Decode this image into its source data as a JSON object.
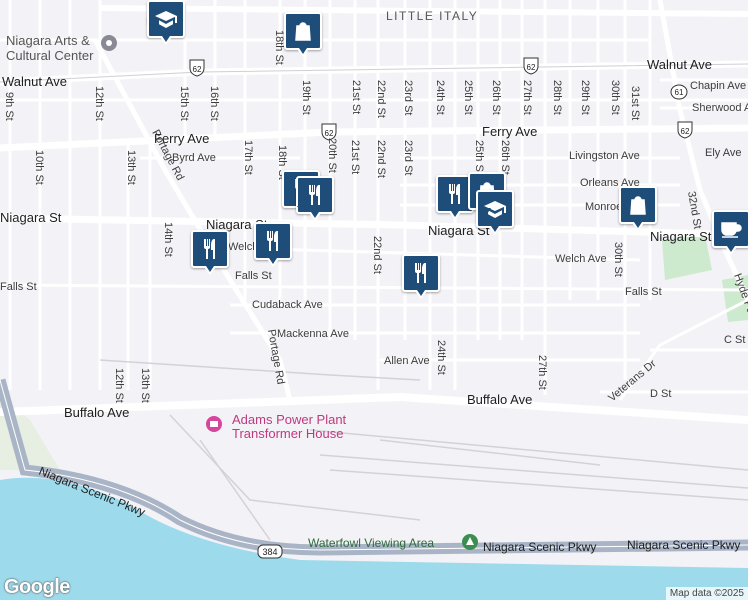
{
  "map": {
    "brand": "Google",
    "attribution": "Map data ©2025",
    "neighborhood": "LITTLE ITALY",
    "places": {
      "arts_center_line1": "Niagara Arts &",
      "arts_center_line2": "Cultural Center",
      "power_plant_line1": "Adams Power Plant",
      "power_plant_line2": "Transformer House",
      "waterfowl": "Waterfowl Viewing Area"
    },
    "shields": {
      "us62": "62",
      "ny384": "384",
      "ny61": "61"
    },
    "roads": {
      "walnut": "Walnut Ave",
      "ferry": "Ferry Ave",
      "niagara": "Niagara St",
      "buffalo": "Buffalo Ave",
      "scenic": "Niagara Scenic Pkwy",
      "portage": "Portage Rd",
      "byrd": "Byrd Ave",
      "falls": "Falls St",
      "cudaback": "Cudaback Ave",
      "mackenna": "Mackenna Ave",
      "allen": "Allen Ave",
      "welch": "Welch Ave",
      "welch_short": "Welch",
      "livingston": "Livingston Ave",
      "orleans": "Orleans Ave",
      "monroe": "Monroe",
      "chapin": "Chapin Ave",
      "sherwood": "Sherwood Ave",
      "ely": "Ely Ave",
      "veterans": "Veterans Dr",
      "cst": "C St",
      "dst": "D St",
      "hyde": "Hyde Park",
      "pi": "Pi"
    },
    "streets": {
      "s9": "9th St",
      "s10": "10th St",
      "s12": "12th St",
      "s13": "13th St",
      "s14": "14th St",
      "s15": "15th St",
      "s16": "16th St",
      "s17": "17th St",
      "s18": "18th St",
      "s19": "19th St",
      "s20": "20th St",
      "s21": "21st St",
      "s22": "22nd St",
      "s23": "23rd St",
      "s24": "24th St",
      "s25": "25th St",
      "s26": "26th St",
      "s27": "27th St",
      "s28": "28th St",
      "s29": "29th St",
      "s30": "30th St",
      "s31": "31st St",
      "s32": "32nd St"
    },
    "pois": [
      {
        "type": "restaurant-icon"
      },
      {
        "type": "restaurant-icon"
      },
      {
        "type": "restaurant-icon"
      },
      {
        "type": "restaurant-icon"
      },
      {
        "type": "restaurant-icon"
      },
      {
        "type": "restaurant-icon"
      },
      {
        "type": "shopping-icon"
      },
      {
        "type": "shopping-icon"
      },
      {
        "type": "shopping-icon"
      },
      {
        "type": "school-icon"
      },
      {
        "type": "school-icon"
      },
      {
        "type": "cafe-icon"
      }
    ],
    "colors": {
      "land": "#f3f2f6",
      "water": "#9ddbec",
      "highway": "#a9b5c7",
      "poi_pin": "#1f4d7a",
      "attraction": "#d6469c"
    }
  }
}
